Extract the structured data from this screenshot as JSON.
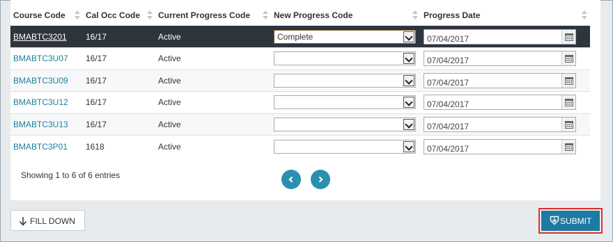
{
  "table": {
    "headers": {
      "course_code": "Course Code",
      "cal_occ_code": "Cal Occ Code",
      "current_progress": "Current Progress Code",
      "new_progress": "New Progress Code",
      "progress_date": "Progress Date"
    },
    "rows": [
      {
        "course_code": "BMABTC3201",
        "cal_occ": "16/17",
        "current": "Active",
        "new_progress": "Complete",
        "date": "07/04/2017",
        "selected": true
      },
      {
        "course_code": "BMABTC3U07",
        "cal_occ": "16/17",
        "current": "Active",
        "new_progress": "",
        "date": "07/04/2017",
        "selected": false
      },
      {
        "course_code": "BMABTC3U09",
        "cal_occ": "16/17",
        "current": "Active",
        "new_progress": "",
        "date": "07/04/2017",
        "selected": false
      },
      {
        "course_code": "BMABTC3U12",
        "cal_occ": "16/17",
        "current": "Active",
        "new_progress": "",
        "date": "07/04/2017",
        "selected": false
      },
      {
        "course_code": "BMABTC3U13",
        "cal_occ": "16/17",
        "current": "Active",
        "new_progress": "",
        "date": "07/04/2017",
        "selected": false
      },
      {
        "course_code": "BMABTC3P01",
        "cal_occ": "1618",
        "current": "Active",
        "new_progress": "",
        "date": "07/04/2017",
        "selected": false
      }
    ]
  },
  "info_text": "Showing 1 to 6 of 6 entries",
  "buttons": {
    "fill_down": "FILL DOWN",
    "submit": "SUBMIT"
  },
  "icons": {
    "prev": "chevron-left-icon",
    "next": "chevron-right-icon",
    "calendar": "calendar-icon",
    "fill_down": "arrow-down-icon",
    "submit": "download-shield-icon"
  },
  "colors": {
    "accent": "#1d7aa3",
    "link": "#1e7f9b",
    "selected_row": "#2f353d",
    "highlight_border": "#d9302a"
  }
}
